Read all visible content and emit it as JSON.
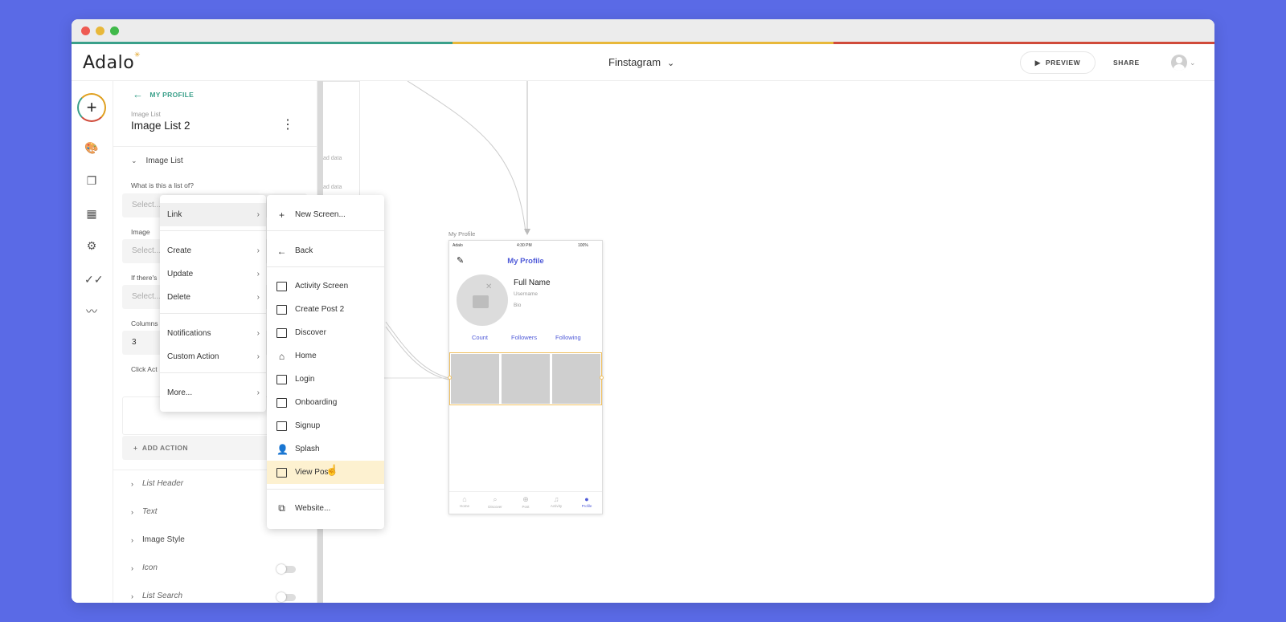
{
  "colors": {
    "background": "#5a6ae6",
    "accent_teal": "#3aa08a",
    "accent_yellow": "#e8b83a",
    "accent_red": "#d04a3a",
    "phone_accent": "#4f5ad8",
    "hover": "#fdf1d0"
  },
  "app": {
    "logo": "Adalo",
    "project_title": "Finstagram",
    "preview_label": "PREVIEW",
    "share_label": "SHARE"
  },
  "rail": {
    "icons": [
      "add-icon",
      "palette-icon",
      "screens-icon",
      "database-icon",
      "gear-icon",
      "publish-icon",
      "analytics-icon"
    ]
  },
  "panel": {
    "back_label": "MY PROFILE",
    "component_type": "Image List",
    "component_name": "Image List 2",
    "section_title": "Image List",
    "q_list_of": "What is this a list of?",
    "select_placeholder": "Select...",
    "image_label": "Image",
    "if_theres_label": "If there's",
    "columns_label": "Columns",
    "columns_value": "3",
    "click_action_label": "Click Act",
    "add_action_label": "ADD ACTION",
    "sections": [
      {
        "label": "List Header"
      },
      {
        "label": "Text"
      },
      {
        "label": "Image Style"
      },
      {
        "label": "Icon"
      },
      {
        "label": "List Search"
      }
    ]
  },
  "canvas": {
    "prev_screen_text_1": "ad data",
    "prev_screen_text_2": "ad data",
    "phone": {
      "label": "My Profile",
      "carrier": "Adalo",
      "time": "4:30 PM",
      "battery": "100%",
      "title": "My Profile",
      "full_name": "Full Name",
      "username": "Username",
      "bio": "Bio",
      "stats": [
        "Count",
        "Followers",
        "Following"
      ],
      "tabs": [
        {
          "label": "Home",
          "icon": "home-icon"
        },
        {
          "label": "Discover",
          "icon": "search-icon"
        },
        {
          "label": "Post",
          "icon": "add-circle-icon"
        },
        {
          "label": "Activity",
          "icon": "bell-icon"
        },
        {
          "label": "Profile",
          "icon": "profile-icon"
        }
      ]
    }
  },
  "menu_actions": {
    "items": [
      "Link",
      "Create",
      "Update",
      "Delete",
      "Notifications",
      "Custom Action",
      "More..."
    ]
  },
  "menu_links": {
    "new_screen": "New Screen...",
    "back": "Back",
    "screens": [
      "Activity Screen",
      "Create Post 2",
      "Discover",
      "Home",
      "Login",
      "Onboarding",
      "Signup",
      "Splash",
      "View Post"
    ],
    "website": "Website..."
  }
}
